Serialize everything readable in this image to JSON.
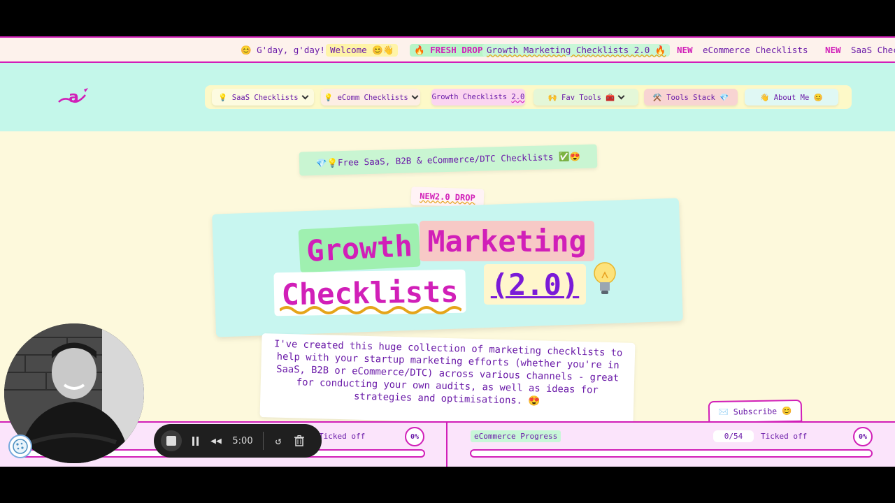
{
  "ticker": {
    "greeting": "😊 G'day, g'day!",
    "welcome": "Welcome 😊👋",
    "fresh_drop": "🔥 FRESH DROP",
    "growth_link": "Growth Marketing Checklists 2.0 🔥",
    "new1": "NEW",
    "ecomm_link": "eCommerce Checklists",
    "new2": "NEW",
    "saas_link": "SaaS Chec"
  },
  "nav": {
    "items": [
      {
        "label": "💡 SaaS Checklists",
        "has_dropdown": true
      },
      {
        "label": "💡 eComm Checklists",
        "has_dropdown": true
      },
      {
        "label_main": "Growth Checklists ",
        "label_version": "2.0",
        "has_dropdown": false
      },
      {
        "label": "🙌 Fav Tools 🧰",
        "has_dropdown": true
      },
      {
        "label": "⚒️ Tools Stack 💎",
        "has_dropdown": false
      },
      {
        "label": "👋 About Me 😊",
        "has_dropdown": false
      }
    ]
  },
  "hero": {
    "free_badge": "💎💡Free SaaS, B2B & eCommerce/DTC Checklists ✅😍",
    "new_badge": "NEW2.0 DROP",
    "title_word1": "Growth",
    "title_word2": "Marketing",
    "title_word3": "Checklists",
    "title_version": "(2.0)",
    "intro": "I've created this huge collection of marketing checklists to help with your startup marketing efforts (whether you're in SaaS, B2B or eCommerce/DTC) across various channels - great for conducting your own audits, as well as ideas for strategies and optimisations. 😍"
  },
  "subscribe": {
    "label": "✉️ Subscribe 😊"
  },
  "progress": {
    "left": {
      "label": "Ticked off",
      "percent_label": "0%",
      "fraction": 0
    },
    "right": {
      "title": "eCommerce Progress",
      "count": "0/54",
      "label": "Ticked off",
      "percent_label": "0%",
      "fraction": 0
    }
  },
  "recorder": {
    "time": "5:00"
  },
  "colors": {
    "accent": "#d11fb8",
    "text": "#6a1aa8",
    "page_bg": "#fdf9dc",
    "nav_bg": "#c4f7ea"
  }
}
